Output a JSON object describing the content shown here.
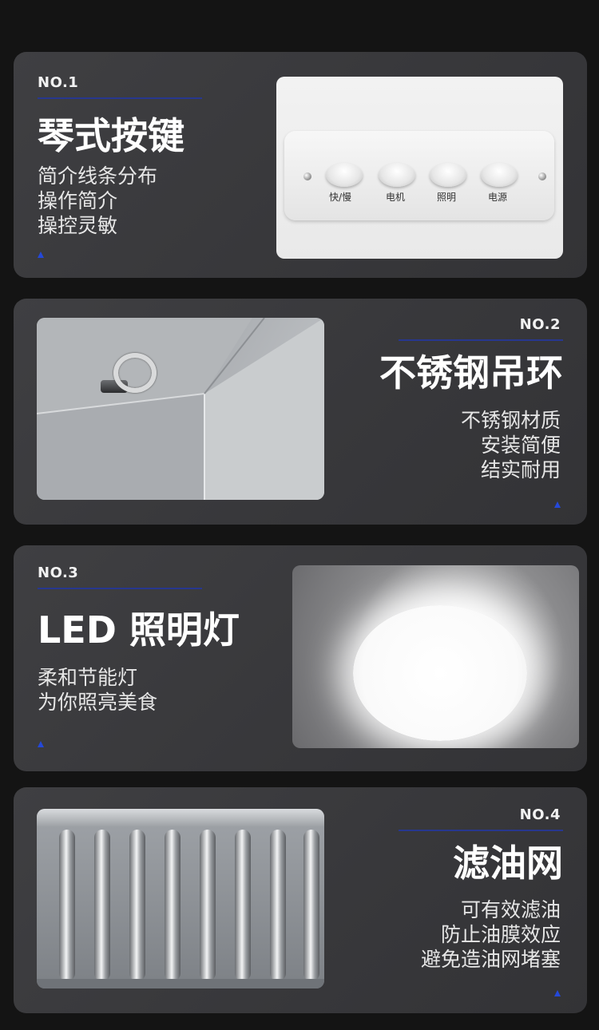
{
  "sections": [
    {
      "no": "NO.1",
      "title": "琴式按键",
      "lines": [
        "简介线条分布",
        "操作简介",
        "操控灵敏"
      ],
      "panel_keys": [
        "快/慢",
        "电机",
        "照明",
        "电源"
      ]
    },
    {
      "no": "NO.2",
      "title": "不锈钢吊环",
      "lines": [
        "不锈钢材质",
        "安装简便",
        "结实耐用"
      ]
    },
    {
      "no": "NO.3",
      "title": "LED 照明灯",
      "lines": [
        "柔和节能灯",
        "为你照亮美食"
      ]
    },
    {
      "no": "NO.4",
      "title": "滤油网",
      "lines": [
        "可有效滤油",
        "防止油膜效应",
        "避免造油网堵塞"
      ]
    }
  ],
  "colors": {
    "page_background": "#141414",
    "card_background": "#3c3c3f",
    "accent_rule": "#27378f",
    "accent_marker": "#2448d8",
    "text_primary": "#ffffff"
  },
  "icons": [
    "triangle-marker-icon"
  ]
}
